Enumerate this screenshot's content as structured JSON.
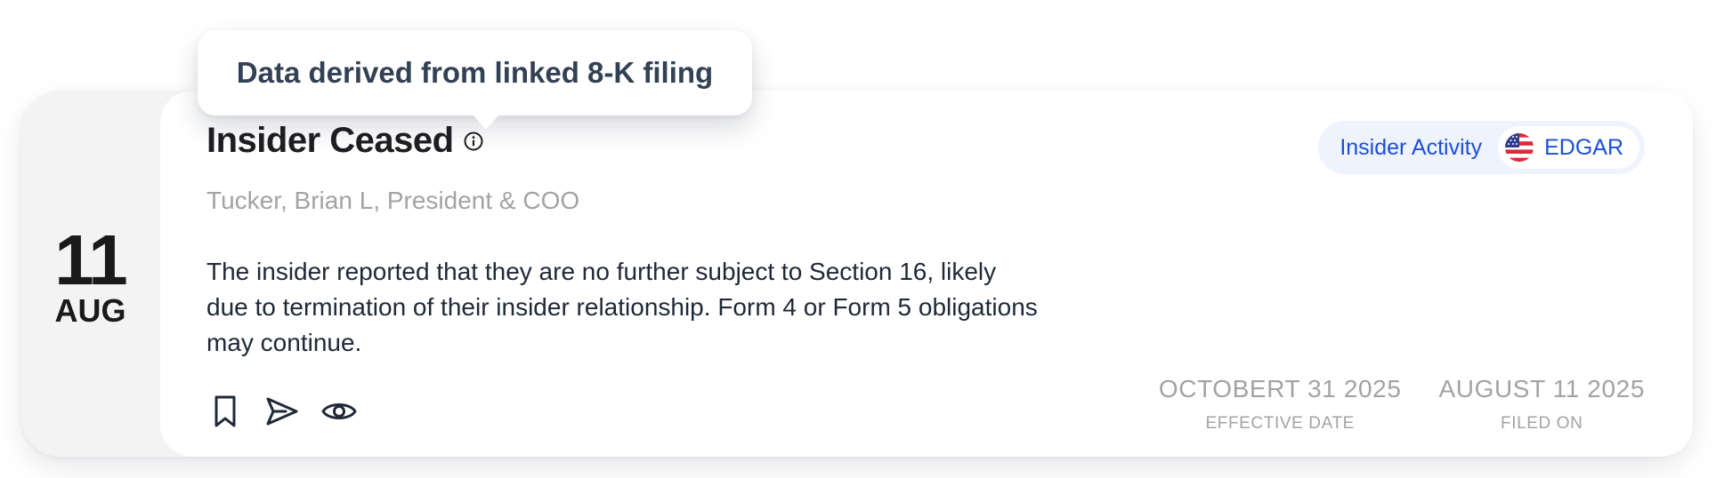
{
  "event": {
    "day": "11",
    "month": "AUG",
    "title": "Insider Ceased",
    "subtitle": "Tucker, Brian L, President & COO",
    "description": "The insider reported that they are no further subject to Section 16, likely due to termination of their insider relationship. Form 4 or Form 5 obligations may continue.",
    "tags": {
      "activity": "Insider Activity",
      "source": "EDGAR",
      "source_icon": "us-flag-icon"
    },
    "dates": [
      {
        "value": "OCTOBERT 31 2025",
        "label": "EFFECTIVE DATE"
      },
      {
        "value": "AUGUST 11 2025",
        "label": "FILED ON"
      }
    ],
    "actions": [
      {
        "name": "bookmark",
        "icon": "bookmark-icon"
      },
      {
        "name": "share",
        "icon": "send-icon"
      },
      {
        "name": "view",
        "icon": "eye-icon"
      }
    ]
  },
  "tooltip": {
    "text": "Data derived from linked 8-K filing"
  },
  "colors": {
    "accent": "#1d4fd8",
    "tag_bg": "#eef3fe",
    "muted": "#a3a3a3",
    "date_col_bg": "#f3f3f4"
  }
}
